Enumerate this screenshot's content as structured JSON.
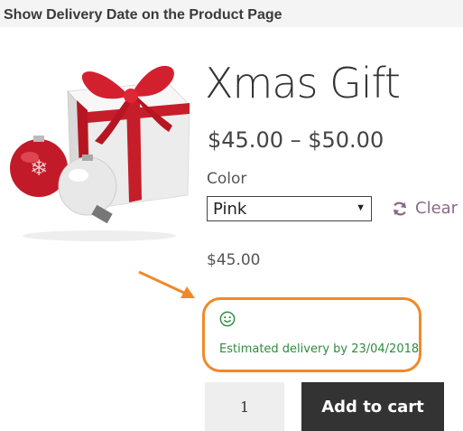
{
  "page": {
    "heading": "Show Delivery Date on the Product Page"
  },
  "product": {
    "title": "Xmas Gift",
    "price_range": "$45.00 – $50.00",
    "variation_price": "$45.00",
    "image_icon": "gift-box-with-ornaments"
  },
  "variation": {
    "label": "Color",
    "selected": "Pink",
    "clear_label": "Clear",
    "clear_icon": "refresh-icon"
  },
  "delivery": {
    "icon": "smiley-icon",
    "text": "Estimated delivery by 23/04/2018"
  },
  "cart": {
    "quantity": "1",
    "add_label": "Add to cart"
  },
  "colors": {
    "accent_orange": "#f0892a",
    "delivery_green": "#2e8b3e",
    "clear_purple": "#8a6a86",
    "button_dark": "#333333"
  }
}
